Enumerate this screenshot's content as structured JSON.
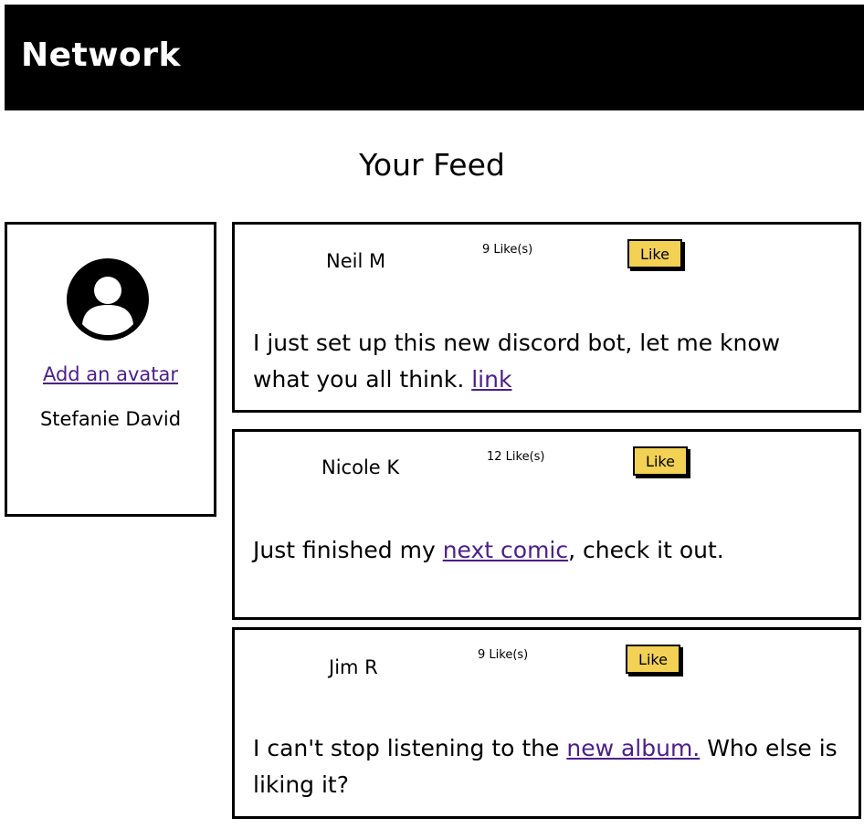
{
  "header": {
    "brand": "Network"
  },
  "feed": {
    "title": "Your Feed"
  },
  "profile": {
    "add_avatar_label": "Add an avatar",
    "name": "Stefanie David"
  },
  "posts": [
    {
      "author": "Neil M",
      "likes": "9 Like(s)",
      "like_label": "Like",
      "text_before": "I just set up this new discord bot, let me know what you all think. ",
      "link_text": "link",
      "text_after": ""
    },
    {
      "author": "Nicole K",
      "likes": "12 Like(s)",
      "like_label": "Like",
      "text_before": "Just finished my ",
      "link_text": "next comic",
      "text_after": ", check it out."
    },
    {
      "author": "Jim R",
      "likes": "9 Like(s)",
      "like_label": "Like",
      "text_before": "I can't stop listening to the ",
      "link_text": "new album.",
      "text_after": " Who else is liking it?"
    }
  ],
  "colors": {
    "header_bg": "#000000",
    "like_button": "#f2d155",
    "link": "#4b1f86"
  }
}
